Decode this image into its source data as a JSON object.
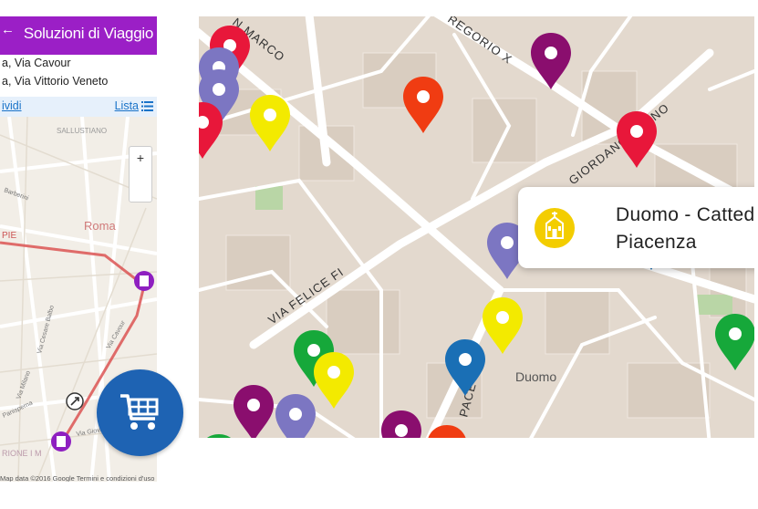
{
  "phone": {
    "header_title": "Soluzioni di Viaggio",
    "back_glyph": "←",
    "from_address": "a, Via Cavour",
    "to_address": "a, Via Vittorio Veneto",
    "share_label": "ividi",
    "list_label": "Lista",
    "list_icon": "list-icon",
    "zoom_in_label": "+",
    "map_labels": {
      "sallustiano": "SALLUSTIANO",
      "roma": "Roma",
      "barberini": "Barberini",
      "via_milano": "Via Milano",
      "via_cesare_balbo": "Via Cesare Balbo",
      "panisperna": "Panisperna",
      "via_giova": "Via Giova",
      "via_cavour": "Via Cavour",
      "rione": "RIONE I M",
      "pie": "PIE"
    },
    "credits": "Map data ©2016 Google  Termini e condizioni d'uso",
    "cart_icon": "shopping-cart-icon",
    "header_color": "#9b1fc6",
    "link_color": "#1a73c8",
    "cart_color": "#1e63b3"
  },
  "bigmap": {
    "popup_title": "Duomo - Cattedrale di Piacenza",
    "popup_icon": "church-icon",
    "popup_icon_color": "#f3cd00",
    "street_labels": {
      "san_marco": "N MARCO",
      "gregorio": "REGORIO X",
      "giordano_bruno": "GIORDANO BRUNO",
      "felice": "VIA FELICE FI",
      "pace": "PACE",
      "duomo": "Duomo"
    },
    "marker_colors": {
      "purple": "#8a0e6e",
      "red": "#e8173a",
      "orange": "#f03c12",
      "yellow": "#f3ea00",
      "lavender": "#7c76c2",
      "blue": "#1a6fb5",
      "green": "#16a83a"
    }
  }
}
